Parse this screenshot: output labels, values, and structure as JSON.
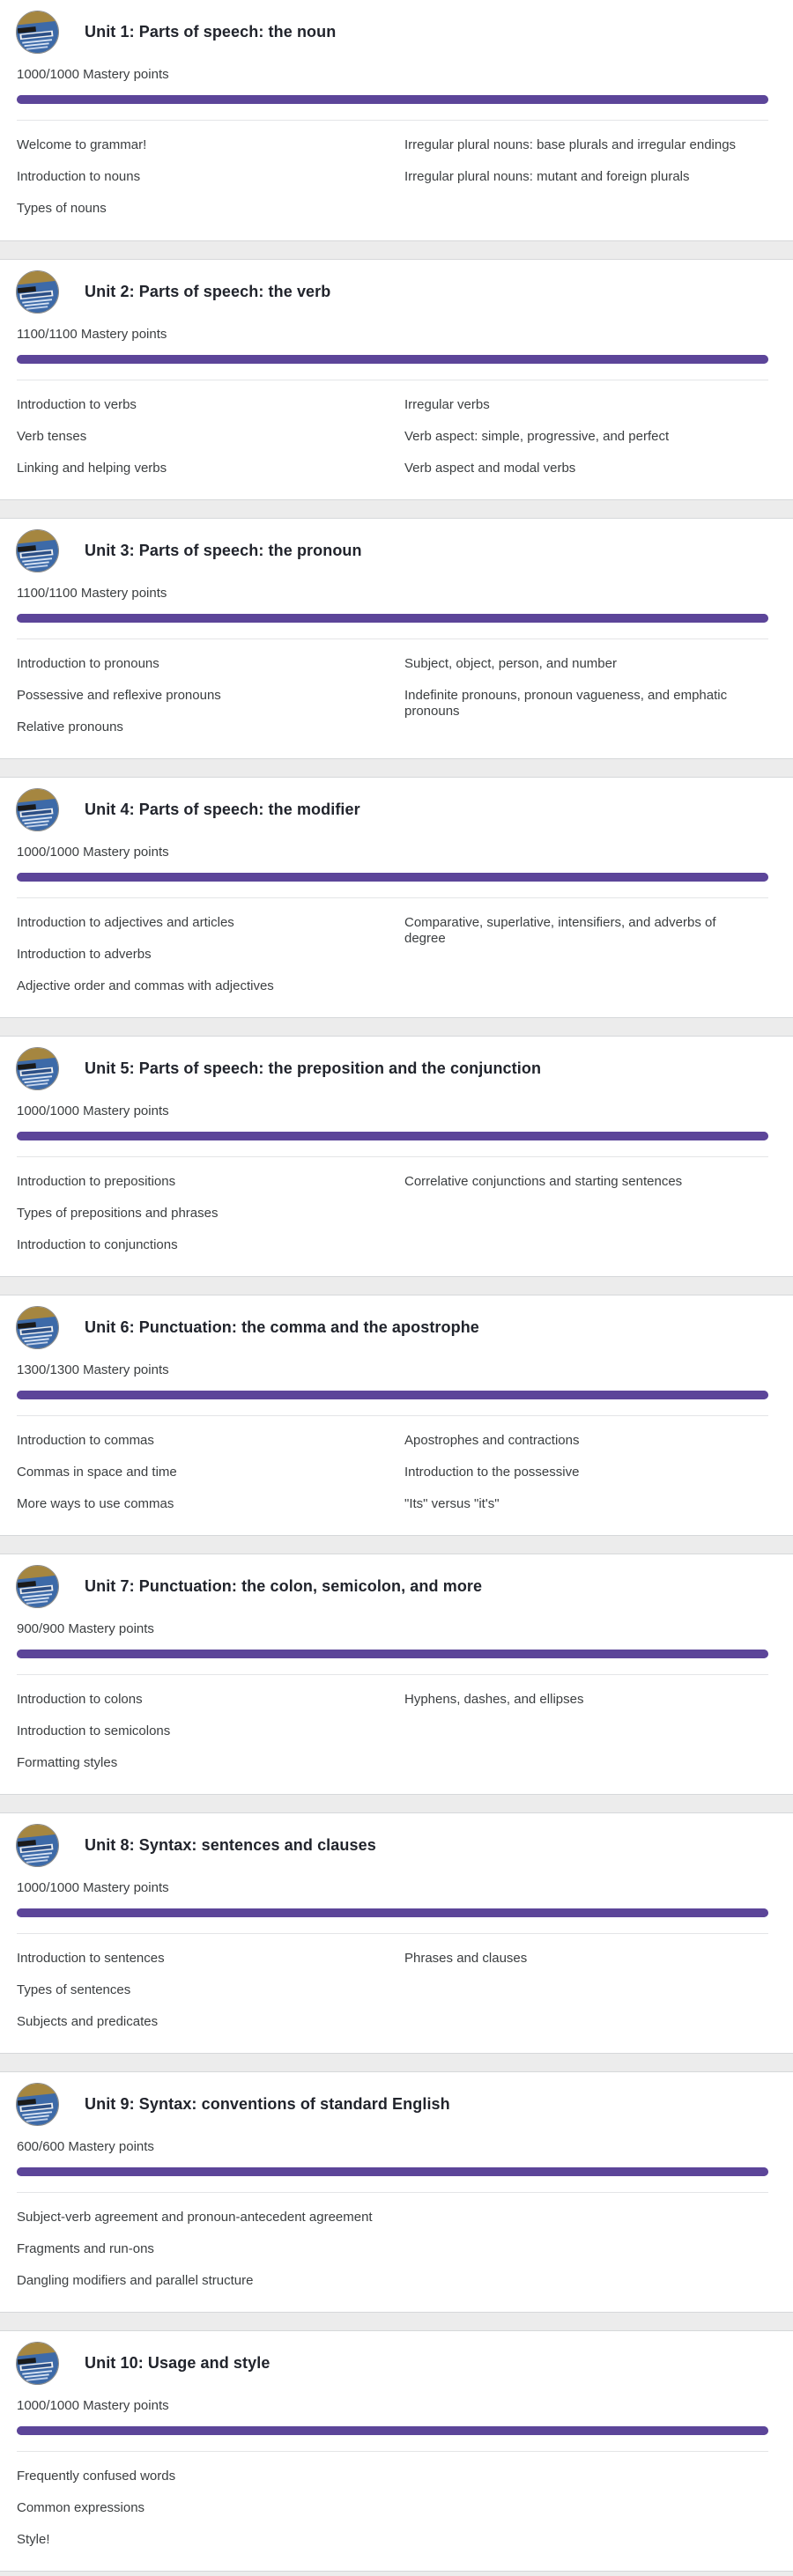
{
  "units": [
    {
      "title": "Unit 1: Parts of speech: the noun",
      "points": "1000/1000 Mastery points",
      "progress": 1.0,
      "left": [
        "Welcome to grammar!",
        "Introduction to nouns",
        "Types of nouns"
      ],
      "right": [
        "Irregular plural nouns: base plurals and irregular endings",
        "Irregular plural nouns: mutant and foreign plurals"
      ]
    },
    {
      "title": "Unit 2: Parts of speech: the verb",
      "points": "1100/1100 Mastery points",
      "progress": 1.0,
      "left": [
        "Introduction to verbs",
        "Verb tenses",
        "Linking and helping verbs"
      ],
      "right": [
        "Irregular verbs",
        "Verb aspect: simple, progressive, and perfect",
        "Verb aspect and modal verbs"
      ]
    },
    {
      "title": "Unit 3: Parts of speech: the pronoun",
      "points": "1100/1100 Mastery points",
      "progress": 1.0,
      "left": [
        "Introduction to pronouns",
        "Possessive and reflexive pronouns",
        "Relative pronouns"
      ],
      "right": [
        "Subject, object, person, and number",
        "Indefinite pronouns, pronoun vagueness, and emphatic pronouns"
      ]
    },
    {
      "title": "Unit 4: Parts of speech: the modifier",
      "points": "1000/1000 Mastery points",
      "progress": 1.0,
      "left": [
        "Introduction to adjectives and articles",
        "Introduction to adverbs",
        "Adjective order and commas with adjectives"
      ],
      "right": [
        "Comparative, superlative, intensifiers, and adverbs of degree"
      ]
    },
    {
      "title": "Unit 5: Parts of speech: the preposition and the conjunction",
      "points": "1000/1000 Mastery points",
      "progress": 1.0,
      "left": [
        "Introduction to prepositions",
        "Types of prepositions and phrases",
        "Introduction to conjunctions"
      ],
      "right": [
        "Correlative conjunctions and starting sentences"
      ]
    },
    {
      "title": "Unit 6: Punctuation: the comma and the apostrophe",
      "points": "1300/1300 Mastery points",
      "progress": 1.0,
      "left": [
        "Introduction to commas",
        "Commas in space and time",
        "More ways to use commas"
      ],
      "right": [
        "Apostrophes and contractions",
        "Introduction to the possessive",
        "\"Its\" versus \"it's\""
      ]
    },
    {
      "title": "Unit 7: Punctuation: the colon, semicolon, and more",
      "points": "900/900 Mastery points",
      "progress": 1.0,
      "left": [
        "Introduction to colons",
        "Introduction to semicolons",
        "Formatting styles"
      ],
      "right": [
        "Hyphens, dashes, and ellipses"
      ]
    },
    {
      "title": "Unit 8: Syntax: sentences and clauses",
      "points": "1000/1000 Mastery points",
      "progress": 1.0,
      "left": [
        "Introduction to sentences",
        "Types of sentences",
        "Subjects and predicates"
      ],
      "right": [
        "Phrases and clauses"
      ]
    },
    {
      "title": "Unit 9: Syntax: conventions of standard English",
      "points": "600/600 Mastery points",
      "progress": 1.0,
      "left": [
        "Subject-verb agreement and pronoun-antecedent agreement",
        "Fragments and run-ons",
        "Dangling modifiers and parallel structure"
      ],
      "right": []
    },
    {
      "title": "Unit 10: Usage and style",
      "points": "1000/1000 Mastery points",
      "progress": 1.0,
      "left": [
        "Frequently confused words",
        "Common expressions",
        "Style!"
      ],
      "right": []
    }
  ],
  "colors": {
    "progress": "#5c4599",
    "card": "#ffffff",
    "background": "#ececec"
  },
  "icons": {
    "unit_avatar": "grammar-book-icon"
  }
}
